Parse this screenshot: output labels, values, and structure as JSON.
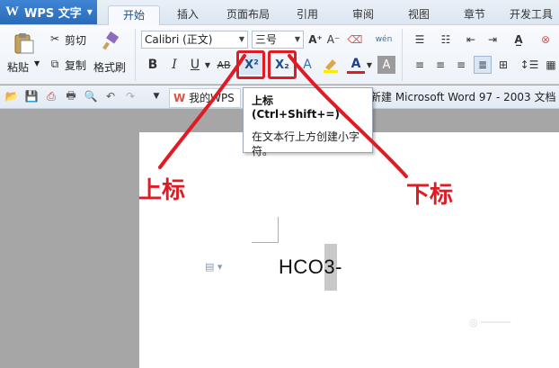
{
  "app": {
    "title": "WPS 文字"
  },
  "tabs": [
    "开始",
    "插入",
    "页面布局",
    "引用",
    "审阅",
    "视图",
    "章节",
    "开发工具"
  ],
  "ribbon": {
    "paste": "粘贴",
    "cut": "剪切",
    "copy": "复制",
    "format_painter": "格式刷",
    "font_name": "Calibri (正文)",
    "font_size": "三号",
    "bold": "B",
    "italic": "I",
    "underline": "U",
    "strike": "AB",
    "superscript": "X²",
    "subscript": "X₂",
    "font_color_glyph": "A",
    "phonetic": "wén"
  },
  "quick_access": {
    "doc_tab_1": "我的WPS",
    "doc_tab_2": "新建 Microsoft Word 97 - 2003 文档"
  },
  "tooltip": {
    "title": "上标 (Ctrl+Shift+=)",
    "body": "在文本行上方创建小字符。"
  },
  "document": {
    "text": "HCO3-"
  },
  "annotations": {
    "superscript": "上标",
    "subscript": "下标"
  },
  "accent": {
    "brand": "#2a6ab8",
    "highlight": "#e01b24"
  }
}
